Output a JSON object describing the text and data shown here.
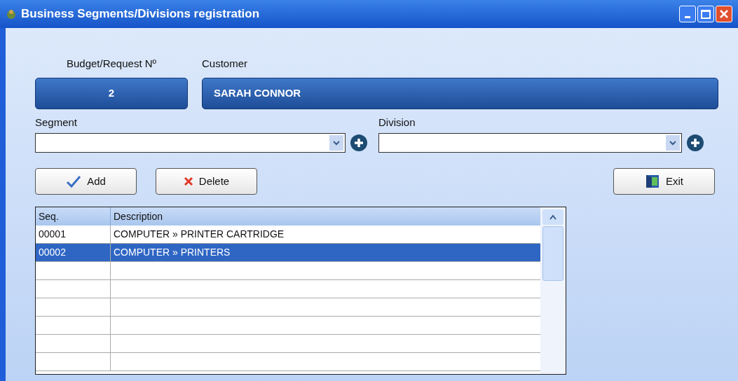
{
  "window": {
    "title": "Business Segments/Divisions registration"
  },
  "budget": {
    "label": "Budget/Request Nº",
    "value": "2"
  },
  "customer": {
    "label": "Customer",
    "value": "SARAH CONNOR"
  },
  "segment": {
    "label": "Segment"
  },
  "division": {
    "label": "Division"
  },
  "buttons": [
    {
      "kind": "check",
      "label": "Add"
    },
    {
      "kind": "cross",
      "label": "Delete"
    },
    {
      "kind": "door",
      "label": "Exit"
    }
  ],
  "table": {
    "columns": [
      "Seq.",
      "Description"
    ],
    "rows": [
      {
        "seq": "00001",
        "description": "COMPUTER » PRINTER CARTRIDGE",
        "selected": false
      },
      {
        "seq": "00002",
        "description": "COMPUTER » PRINTERS",
        "selected": true
      }
    ]
  }
}
